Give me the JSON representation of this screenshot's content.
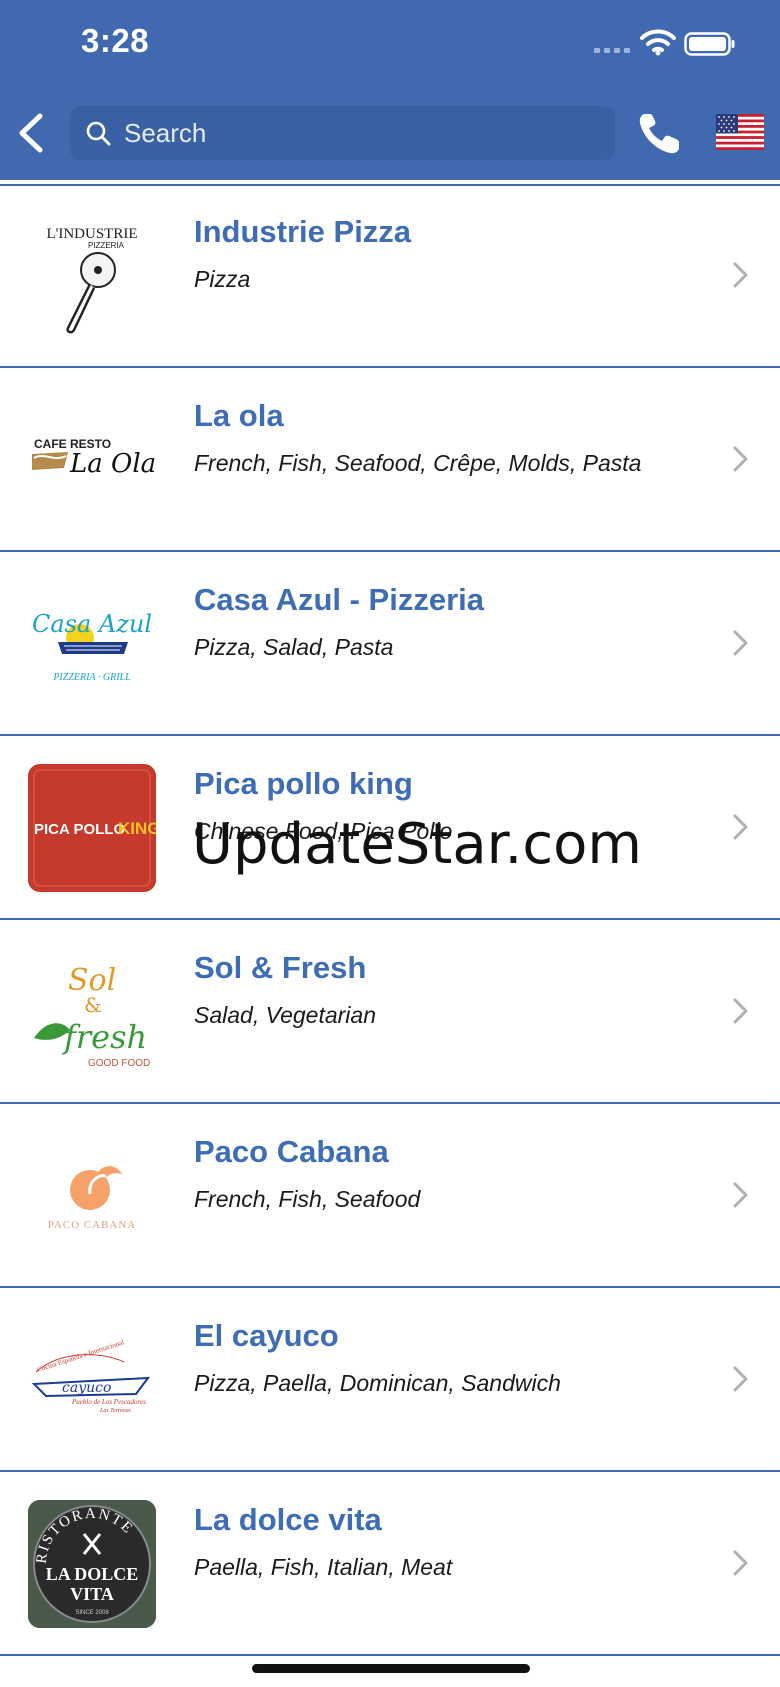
{
  "status_bar": {
    "time": "3:28"
  },
  "header": {
    "search": {
      "placeholder": "Search",
      "value": ""
    },
    "icons": [
      "back-chevron-icon",
      "search-icon",
      "phone-icon",
      "us-flag-icon"
    ]
  },
  "restaurants": [
    {
      "name": "Industrie Pizza",
      "cuisines": "Pizza",
      "logo": {
        "lines": [
          "L'INDUSTRIE",
          "PIZZERIA"
        ],
        "color": "#222222"
      }
    },
    {
      "name": "La ola",
      "cuisines": "French, Fish, Seafood, Crêpe, Molds, Pasta",
      "logo": {
        "lines": [
          "CAFE RESTO",
          "La Ola"
        ],
        "color": "#222222"
      }
    },
    {
      "name": "Casa Azul - Pizzeria",
      "cuisines": "Pizza, Salad, Pasta",
      "logo": {
        "lines": [
          "Casa Azul",
          "PIZZERIA · GRILL"
        ],
        "color": "#1aa3c9"
      }
    },
    {
      "name": "Pica pollo king",
      "cuisines": "Chinese Food, Pica Pollo",
      "logo": {
        "lines": [
          "PICA POLLO",
          "KING"
        ],
        "color": "#c53a2c"
      }
    },
    {
      "name": "Sol & Fresh",
      "cuisines": "Salad, Vegetarian",
      "logo": {
        "lines": [
          "Sol",
          "&",
          "fresh",
          "GOOD FOOD"
        ],
        "color": "#e09a2a"
      }
    },
    {
      "name": "Paco Cabana",
      "cuisines": "French, Fish, Seafood",
      "logo": {
        "lines": [
          "PACO CABANA"
        ],
        "color": "#f0a070"
      }
    },
    {
      "name": "El cayuco",
      "cuisines": "Pizza, Paella, Dominican, Sandwich",
      "logo": {
        "lines": [
          "Cocina Española e Internacional",
          "cayuco",
          "Pueblo de Los Pescadores",
          "Las Terrenas"
        ],
        "color": "#1c3a9a"
      }
    },
    {
      "name": "La dolce vita",
      "cuisines": "Paella, Fish, Italian, Meat",
      "logo": {
        "lines": [
          "RISTORANTE",
          "LA DOLCE",
          "VITA",
          "SINCE 2008"
        ],
        "color": "#2a2a2a"
      }
    }
  ],
  "watermark": "UpdateStar.com",
  "colors": {
    "header": "#4169B0",
    "title": "#3e6db5",
    "divider": "#4169B0"
  }
}
